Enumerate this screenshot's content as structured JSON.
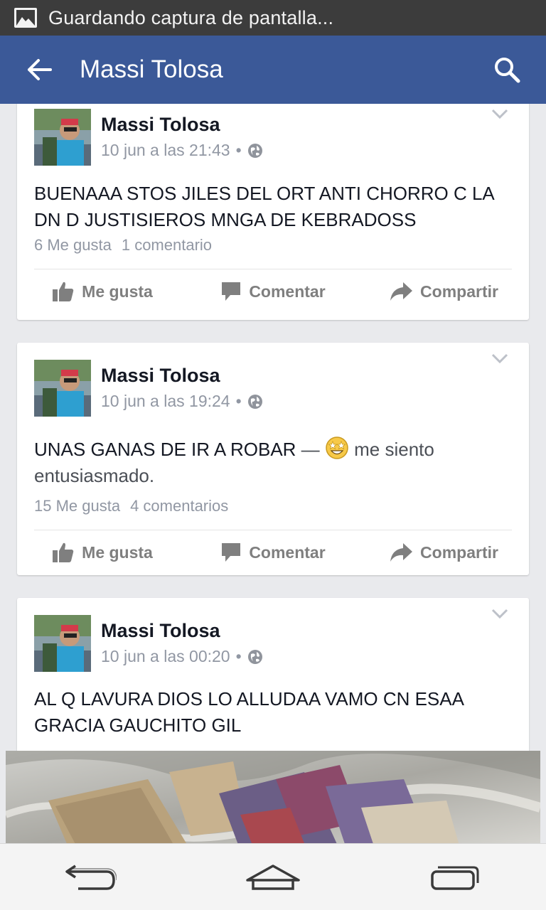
{
  "status_bar": {
    "text": "Guardando captura de pantalla...",
    "icon": "image-icon"
  },
  "app_bar": {
    "title": "Massi Tolosa",
    "back_icon": "arrow-left-icon",
    "search_icon": "search-icon",
    "color": "#3b5998"
  },
  "actions": {
    "like": "Me gusta",
    "comment": "Comentar",
    "share": "Compartir"
  },
  "posts": [
    {
      "author": "Massi Tolosa",
      "time": "10 jun a las 21:43",
      "separator": "•",
      "text": "BUENAAA STOS JILES DEL ORT ANTI CHORRO C LA DN D JUSTISIEROS MNGA DE KEBRADOSS",
      "likes": "6 Me gusta",
      "comments": "1 comentario"
    },
    {
      "author": "Massi Tolosa",
      "time": "10 jun a las 19:24",
      "separator": "•",
      "text": "UNAS GANAS DE IR A ROBAR",
      "feeling_sep": "—",
      "feeling": "me siento entusiasmado.",
      "likes": "15 Me gusta",
      "comments": "4 comentarios"
    },
    {
      "author": "Massi Tolosa",
      "time": "10 jun a las 00:20",
      "separator": "•",
      "text": "AL Q LAVURA DIOS LO ALLUDAA VAMO CN ESAA GRACIA GAUCHITO GIL"
    }
  ],
  "nav_bar": {
    "back": "nav-back-icon",
    "home": "nav-home-icon",
    "recents": "nav-recents-icon"
  }
}
